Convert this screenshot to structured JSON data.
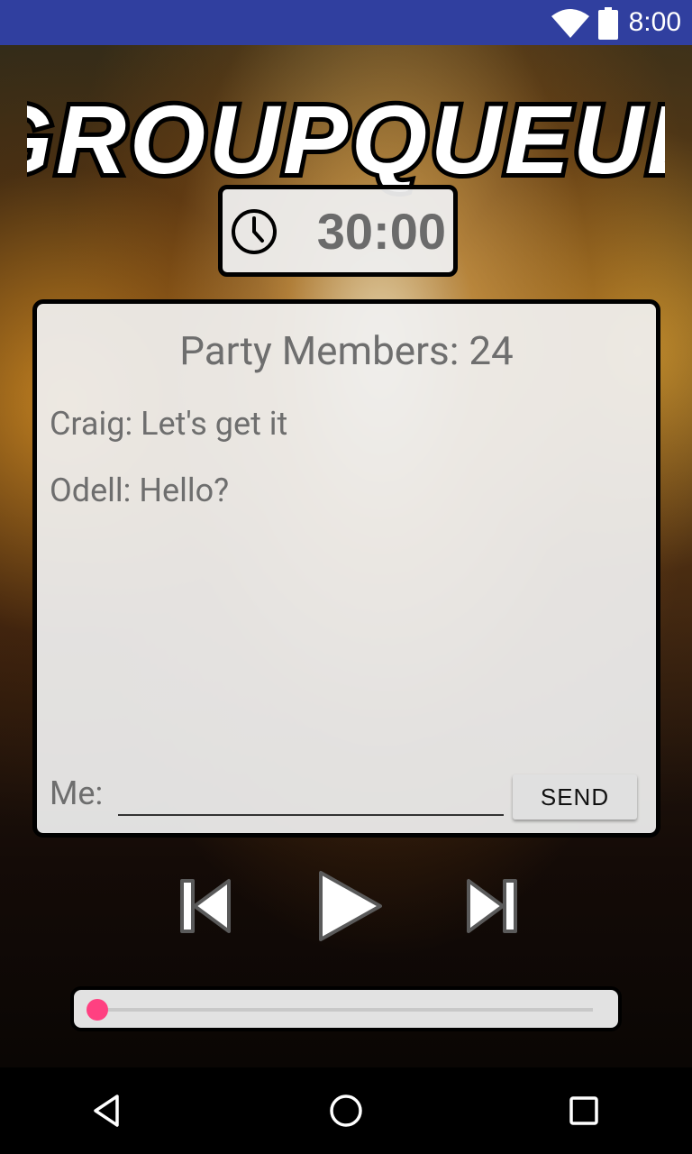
{
  "status_bar": {
    "time": "8:00"
  },
  "app": {
    "title": "GROUPQUEUE"
  },
  "timer": {
    "value": "30:00",
    "icon": "clock-icon"
  },
  "chat": {
    "members_label": "Party Members: 24",
    "messages": [
      {
        "text": "Craig: Let's get it"
      },
      {
        "text": "Odell: Hello?"
      }
    ],
    "me_label": "Me:",
    "input_value": "",
    "send_label": "SEND"
  },
  "player": {
    "controls": [
      "skip-previous-icon",
      "play-icon",
      "skip-next-icon"
    ],
    "progress": 0.0,
    "accent_color": "#FF4081"
  },
  "nav": {
    "buttons": [
      "back-icon",
      "home-icon",
      "recents-icon"
    ]
  },
  "colors": {
    "status_bar": "#303F9F",
    "panel": "#F0F0F0"
  }
}
